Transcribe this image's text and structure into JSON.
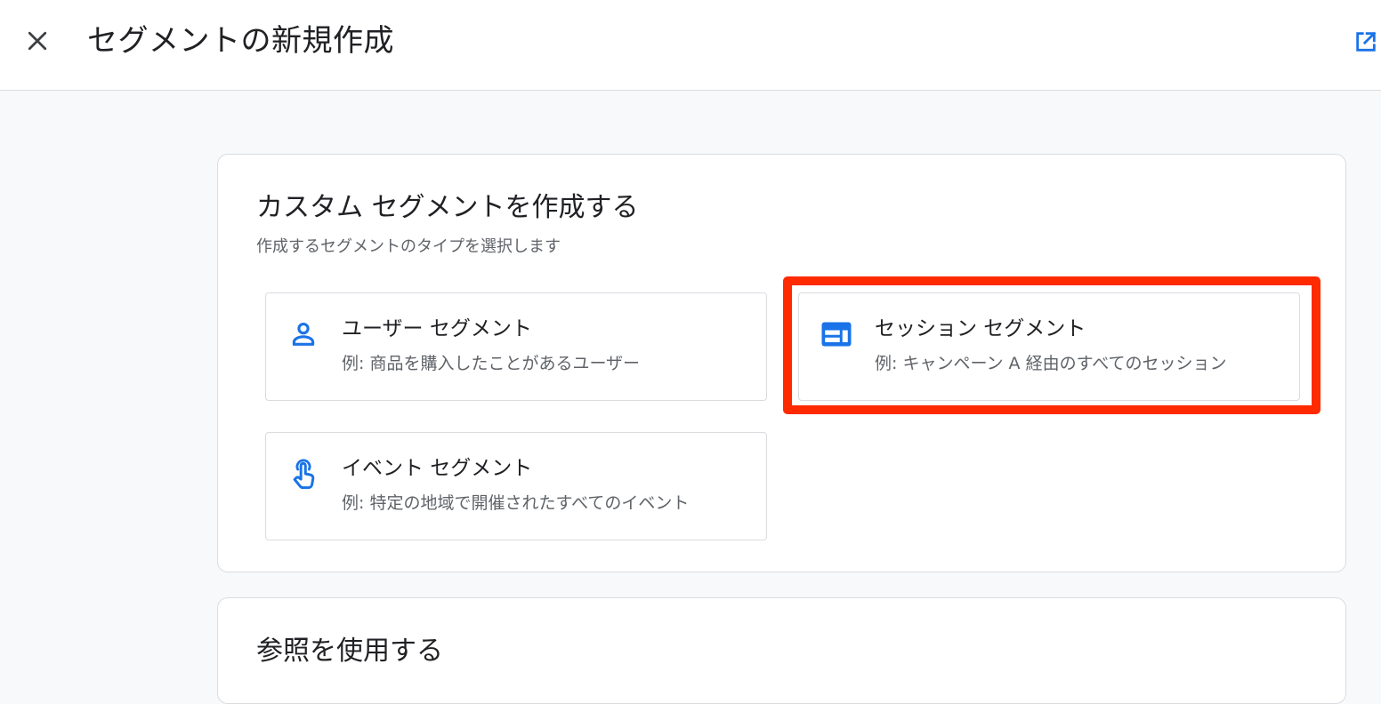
{
  "header": {
    "title": "セグメントの新規作成",
    "close_icon": "close-icon",
    "external_icon": "open-in-new-icon"
  },
  "custom_segment": {
    "title": "カスタム セグメントを作成する",
    "subtitle": "作成するセグメントのタイプを選択します",
    "options": [
      {
        "icon": "person-icon",
        "title": "ユーザー セグメント",
        "example": "例: 商品を購入したことがあるユーザー"
      },
      {
        "icon": "web-session-icon",
        "title": "セッション セグメント",
        "example": "例: キャンペーン A 経由のすべてのセッション",
        "highlighted": true
      },
      {
        "icon": "touch-hand-icon",
        "title": "イベント セグメント",
        "example": "例: 特定の地域で開催されたすべてのイベント"
      }
    ]
  },
  "reference_section": {
    "title": "参照を使用する"
  },
  "colors": {
    "accent_blue": "#1a73e8",
    "highlight_red": "#ff2a00",
    "background": "#f8f9fa",
    "border": "#dadce0"
  }
}
